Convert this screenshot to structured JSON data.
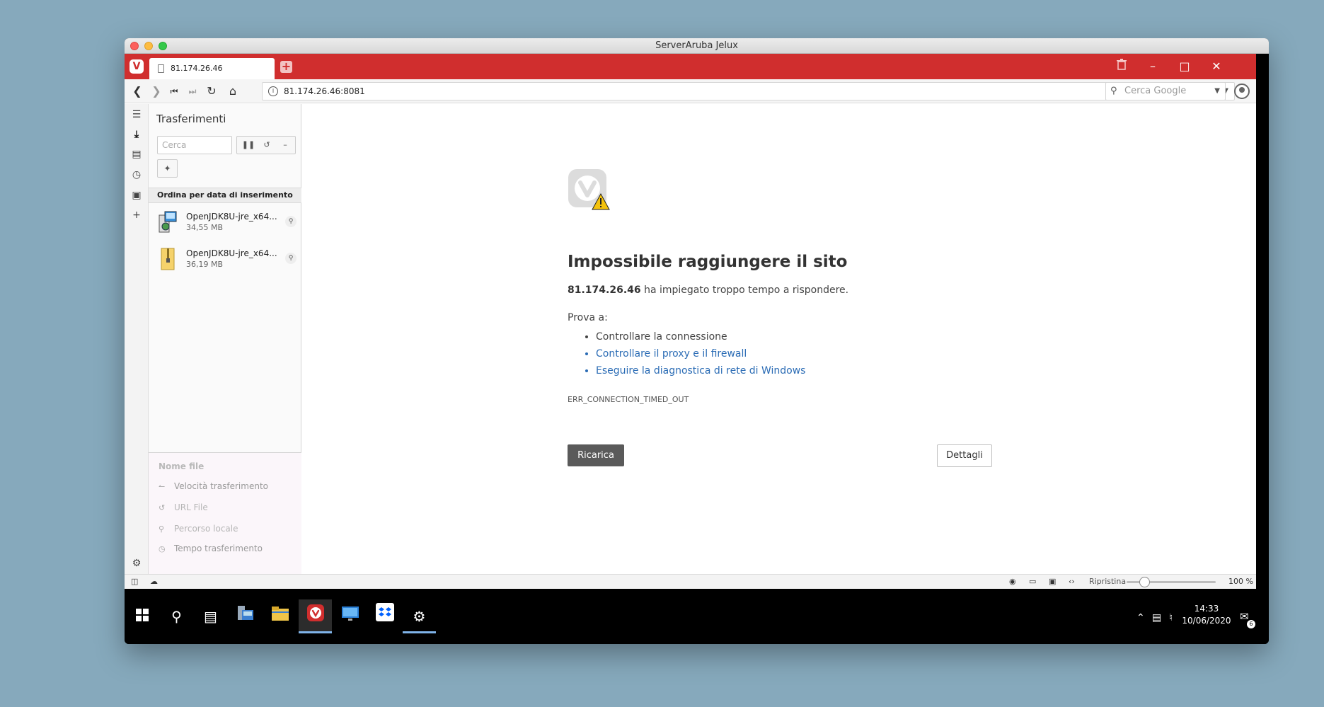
{
  "mac": {
    "title": "ServerAruba Jelux"
  },
  "browser": {
    "tab_title": "81.174.26.46",
    "url": "81.174.26.46:8081",
    "search_placeholder": "Cerca Google"
  },
  "downloads": {
    "title": "Trasferimenti",
    "search_placeholder": "Cerca",
    "sort_label": "Ordina per data di inserimento",
    "items": [
      {
        "name": "OpenJDK8U-jre_x64...",
        "size": "34,55 MB",
        "icon": "installer-icon"
      },
      {
        "name": "OpenJDK8U-jre_x64...",
        "size": "36,19 MB",
        "icon": "zip-icon"
      }
    ],
    "details": {
      "filename": "Nome file",
      "speed": "Velocità trasferimento",
      "url": "URL File",
      "path": "Percorso locale",
      "time": "Tempo trasferimento"
    }
  },
  "error_page": {
    "title": "Impossibile raggiungere il sito",
    "host": "81.174.26.46",
    "message": "ha impiegato troppo tempo a rispondere.",
    "try_label": "Prova a:",
    "suggestions": [
      "Controllare la connessione",
      "Controllare il proxy e il firewall",
      "Eseguire la diagnostica di rete di Windows"
    ],
    "code": "ERR_CONNECTION_TIMED_OUT",
    "reload_label": "Ricarica",
    "details_label": "Dettagli"
  },
  "statusbar": {
    "reset_label": "Ripristina",
    "zoom": "100 %"
  },
  "taskbar": {
    "time": "14:33",
    "date": "10/06/2020",
    "notifications": "6"
  },
  "colors": {
    "vivaldi_red": "#d02e2e",
    "link_blue": "#2b6cb5",
    "desktop": "#86a9bc"
  }
}
